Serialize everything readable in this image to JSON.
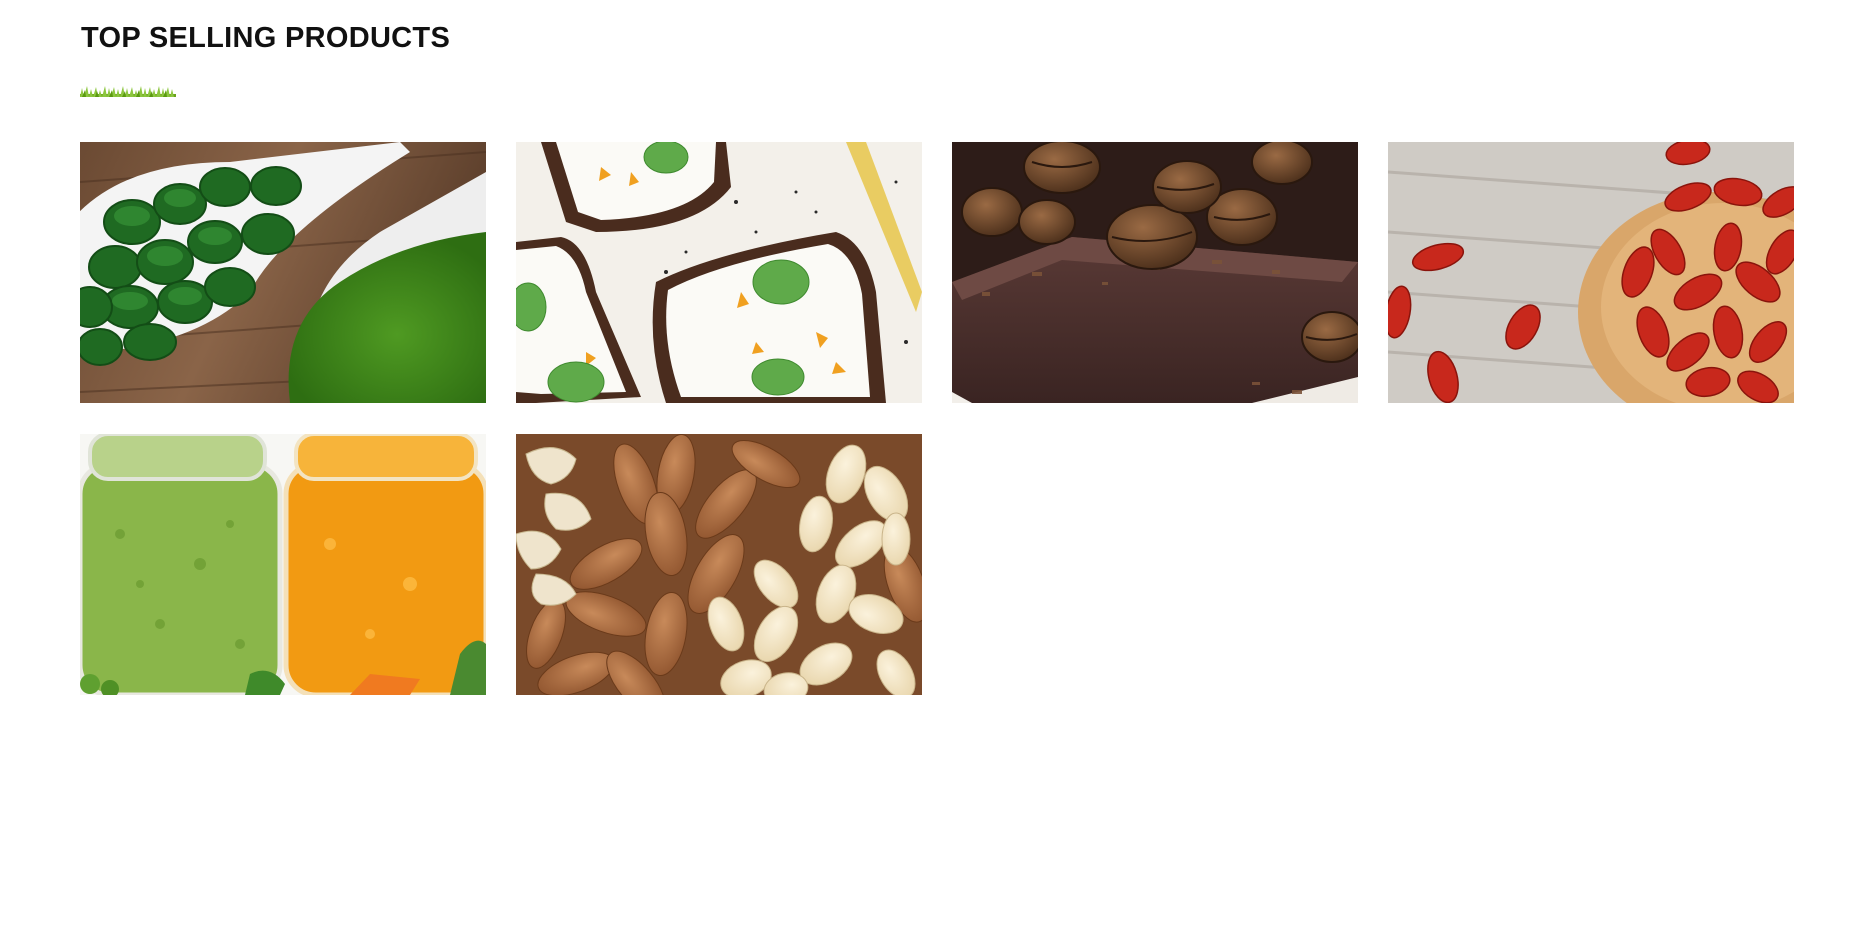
{
  "section": {
    "title": "TOP SELLING PRODUCTS"
  },
  "accent_color": "#7ab51d",
  "products": [
    {
      "id": "spirulina",
      "image": "green spirulina tablets and powder on white spoons"
    },
    {
      "id": "toast",
      "image": "rye toast with cream cheese, mint and chia seeds"
    },
    {
      "id": "chocolate",
      "image": "dark chocolate bar with coffee beans"
    },
    {
      "id": "goji",
      "image": "dried goji berries in wooden spoon"
    },
    {
      "id": "puree",
      "image": "green and orange vegetable puree jars"
    },
    {
      "id": "nuts",
      "image": "almonds, pine nuts and cashews"
    }
  ]
}
